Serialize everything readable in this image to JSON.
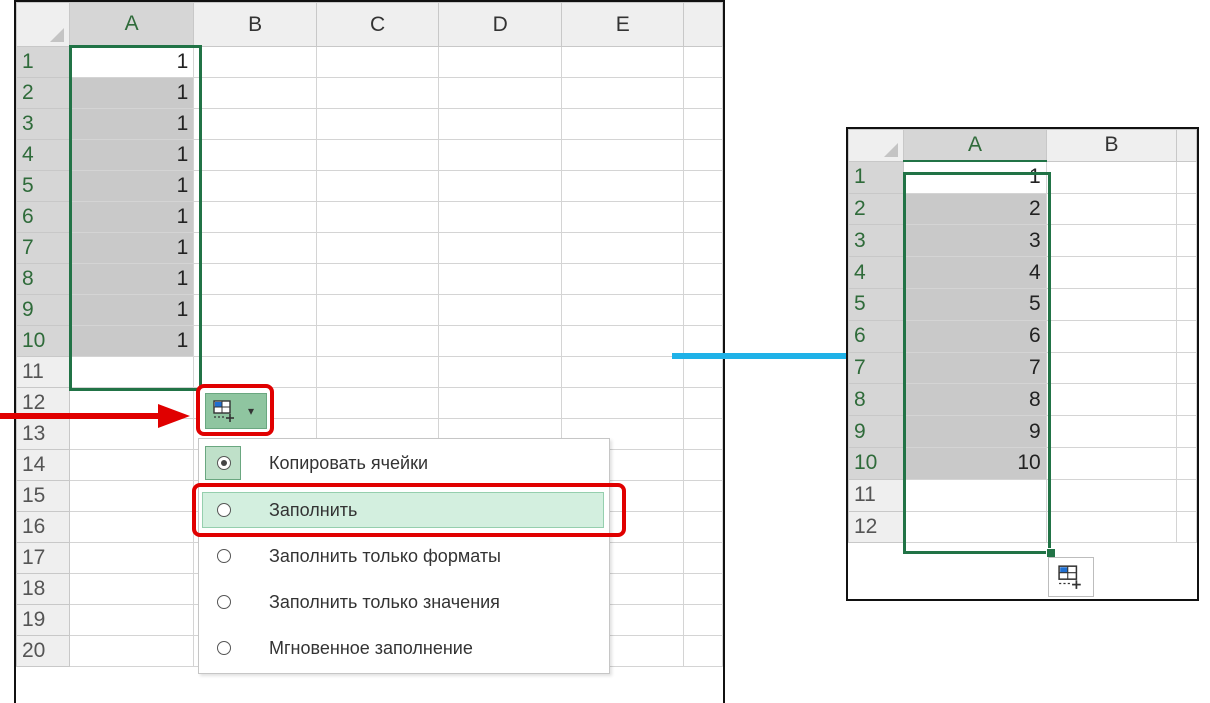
{
  "left_sheet": {
    "columns": [
      "A",
      "B",
      "C",
      "D",
      "E"
    ],
    "rows": [
      "1",
      "2",
      "3",
      "4",
      "5",
      "6",
      "7",
      "8",
      "9",
      "10",
      "11",
      "12",
      "13",
      "14",
      "15",
      "16",
      "17",
      "18",
      "19",
      "20"
    ],
    "values": [
      "1",
      "1",
      "1",
      "1",
      "1",
      "1",
      "1",
      "1",
      "1",
      "1"
    ]
  },
  "autofill_button": {
    "icon": "autofill-options-icon",
    "caret": "▾"
  },
  "menu": {
    "items": [
      {
        "label": "Копировать ячейки",
        "selected": true
      },
      {
        "label": "Заполнить",
        "selected": false,
        "highlighted": true
      },
      {
        "label": "Заполнить только форматы",
        "selected": false
      },
      {
        "label": "Заполнить только значения",
        "selected": false
      },
      {
        "label": "Мгновенное заполнение",
        "selected": false
      }
    ]
  },
  "right_sheet": {
    "columns": [
      "A",
      "B"
    ],
    "rows": [
      "1",
      "2",
      "3",
      "4",
      "5",
      "6",
      "7",
      "8",
      "9",
      "10",
      "11",
      "12"
    ],
    "values": [
      "1",
      "2",
      "3",
      "4",
      "5",
      "6",
      "7",
      "8",
      "9",
      "10"
    ]
  },
  "colors": {
    "selection": "#217346",
    "callout": "#e00000",
    "arrow_blue": "#1fb2e8"
  }
}
